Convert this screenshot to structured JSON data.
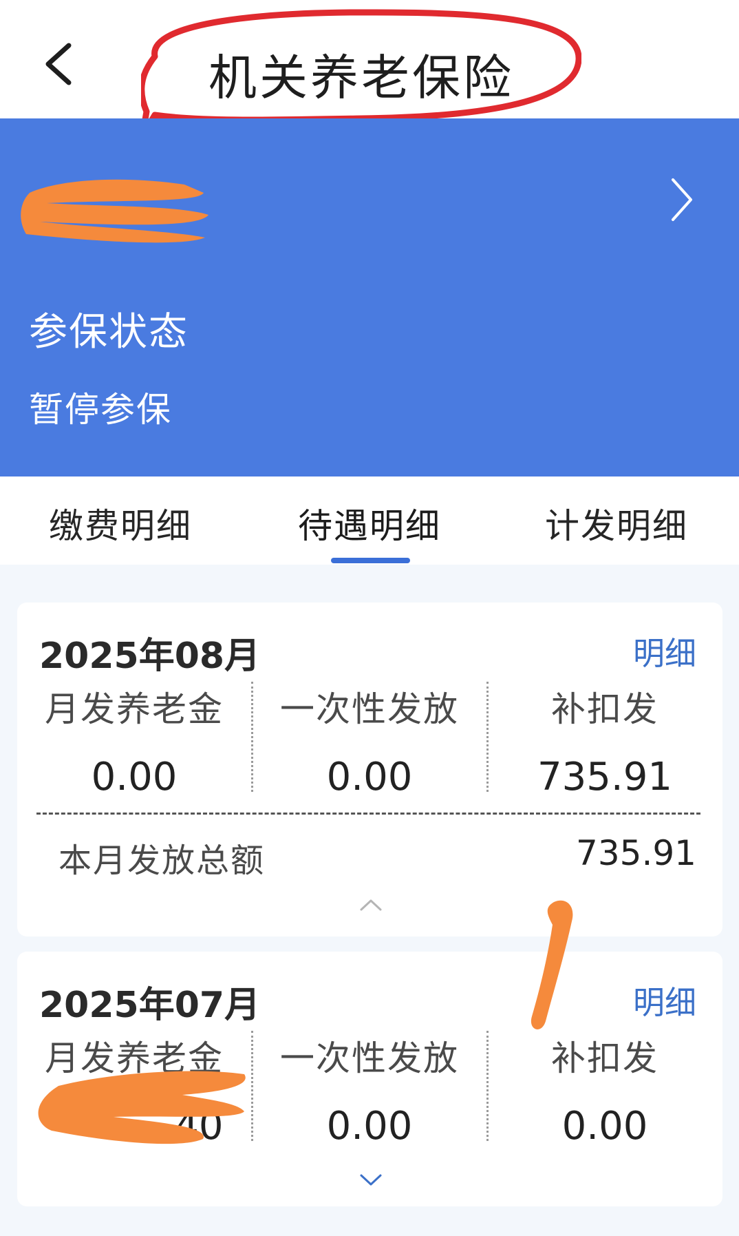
{
  "header": {
    "title": "机关养老保险",
    "back_icon": "chevron-left-icon",
    "highlight_color": "#e02a2f"
  },
  "banner": {
    "background": "#4a7be0",
    "status_label": "参保状态",
    "status_value": "暂停参保",
    "detail_icon": "chevron-right-icon"
  },
  "tabs": {
    "items": [
      {
        "label": "缴费明细",
        "active": false
      },
      {
        "label": "待遇明细",
        "active": true
      },
      {
        "label": "计发明细",
        "active": false
      }
    ],
    "indicator_color": "#3b6fd8"
  },
  "records": [
    {
      "month": "2025年08月",
      "detail_label": "明细",
      "columns": [
        {
          "label": "月发养老金",
          "value": "0.00"
        },
        {
          "label": "一次性发放",
          "value": "0.00"
        },
        {
          "label": "补扣发",
          "value": "735.91"
        }
      ],
      "total_label": "本月发放总额",
      "total_value": "735.91",
      "expanded": true
    },
    {
      "month": "2025年07月",
      "detail_label": "明细",
      "columns": [
        {
          "label": "月发养老金",
          "value": ".40"
        },
        {
          "label": "一次性发放",
          "value": "0.00"
        },
        {
          "label": "补扣发",
          "value": "0.00"
        }
      ],
      "expanded": false
    }
  ],
  "redaction_color": "#f58a3c"
}
